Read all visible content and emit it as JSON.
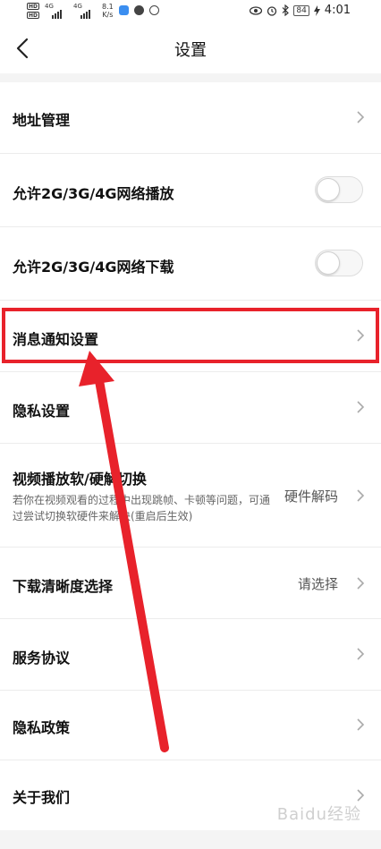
{
  "status_bar": {
    "hd1": "HD",
    "hd2": "HD",
    "net1": "4G",
    "net2": "4G",
    "speed_value": "8.1",
    "speed_unit": "K/s",
    "battery": "84",
    "time": "4:01"
  },
  "nav": {
    "title": "设置"
  },
  "settings": {
    "address": {
      "label": "地址管理"
    },
    "allow_play": {
      "label": "允许2G/3G/4G网络播放",
      "enabled": false
    },
    "allow_download": {
      "label": "允许2G/3G/4G网络下载",
      "enabled": false
    },
    "notification": {
      "label": "消息通知设置"
    },
    "privacy_settings": {
      "label": "隐私设置"
    },
    "decode": {
      "label": "视频播放软/硬解切换",
      "description": "若你在视频观看的过程中出现跳帧、卡顿等问题，可通过尝试切换软硬件来解决(重启后生效)",
      "value": "硬件解码"
    },
    "download_quality": {
      "label": "下载清晰度选择",
      "value": "请选择"
    },
    "service_agreement": {
      "label": "服务协议"
    },
    "privacy_policy": {
      "label": "隐私政策"
    },
    "about": {
      "label": "关于我们"
    }
  },
  "annotation": {
    "color": "#e8222b"
  },
  "watermark": "Baidu经验"
}
